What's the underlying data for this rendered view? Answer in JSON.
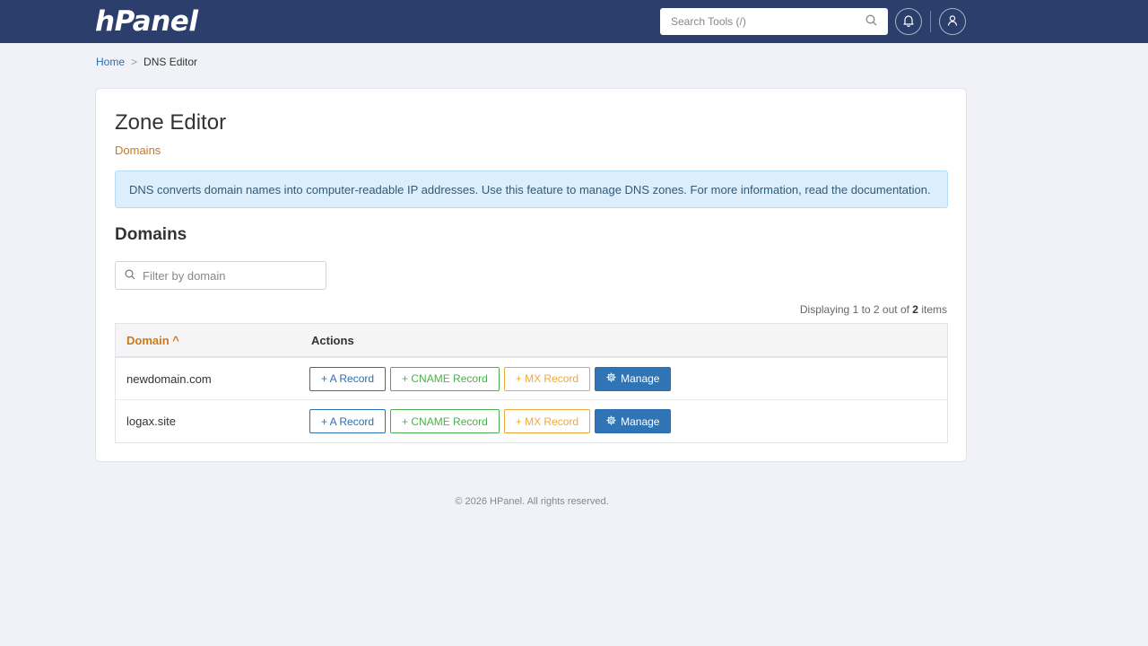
{
  "header": {
    "logo": "hPanel",
    "search_placeholder": "Search Tools (/)"
  },
  "breadcrumb": {
    "home": "Home",
    "separator": ">",
    "current": "DNS Editor"
  },
  "page": {
    "title": "Zone Editor",
    "subtitle": "Domains",
    "info": "DNS converts domain names into computer-readable IP addresses. Use this feature to manage DNS zones. For more information, read the documentation.",
    "section_title": "Domains",
    "filter_placeholder": "Filter by domain"
  },
  "pagination": {
    "prefix": "Displaying 1 to 2 out of",
    "total": "2",
    "suffix": "items"
  },
  "table": {
    "col_domain": "Domain ^",
    "col_actions": "Actions",
    "rows": [
      {
        "domain": "newdomain.com"
      },
      {
        "domain": "logax.site"
      }
    ],
    "buttons": {
      "a_record": "+ A Record",
      "cname_record": "+ CNAME Record",
      "mx_record": "+ MX Record",
      "manage": "Manage"
    }
  },
  "footer": {
    "text": "© 2026 HPanel. All rights reserved."
  },
  "colors": {
    "topbar": "#2c3e6b",
    "accent_orange": "#c87a1e",
    "primary_blue": "#2f74b5",
    "green": "#4caf50",
    "amber": "#f0a83a"
  }
}
